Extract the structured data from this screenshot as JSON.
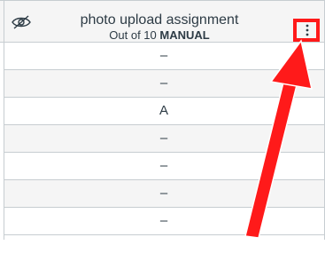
{
  "column": {
    "title": "photo upload assignment",
    "points_prefix": "Out of 10",
    "grading_type": "MANUAL"
  },
  "icons": {
    "visibility": "eye-slash-icon",
    "menu": "kebab-menu-icon"
  },
  "rows": [
    {
      "value": "–"
    },
    {
      "value": "–"
    },
    {
      "value": "A"
    },
    {
      "value": "–"
    },
    {
      "value": "–"
    },
    {
      "value": "–"
    },
    {
      "value": "–"
    }
  ],
  "colors": {
    "highlight": "#ff1a1a",
    "grid_line": "#c7cdd1",
    "row_alt": "#f5f5f5",
    "text": "#2d3b45"
  }
}
